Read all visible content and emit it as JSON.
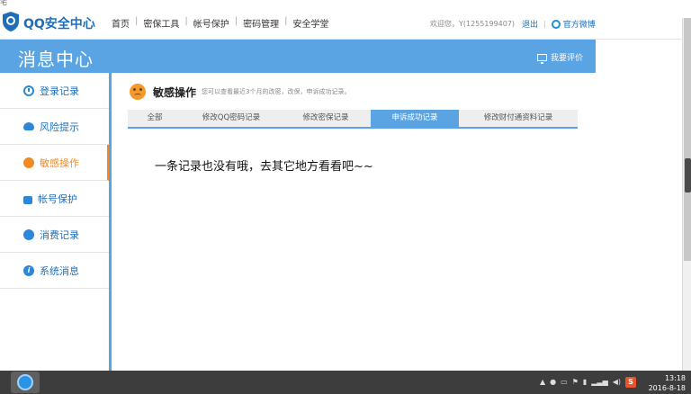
{
  "window": {
    "top_char": "宅"
  },
  "header": {
    "logo_text": "QQ安全中心",
    "nav": [
      "首页",
      "密保工具",
      "帐号保护",
      "密码管理",
      "安全学堂"
    ],
    "welcome": "欢迎您，Y(1255199407)",
    "logout": "退出",
    "weibo": "官方微博"
  },
  "banner": {
    "title": "消息中心",
    "feedback": "我要评价"
  },
  "sidebar": {
    "items": [
      {
        "label": "登录记录",
        "icon": "clock-icon"
      },
      {
        "label": "风险提示",
        "icon": "cloud-icon"
      },
      {
        "label": "敏感操作",
        "icon": "face-icon",
        "active": true
      },
      {
        "label": "帐号保护",
        "icon": "lock-icon"
      },
      {
        "label": "消费记录",
        "icon": "cart-icon"
      },
      {
        "label": "系统消息",
        "icon": "info-icon"
      }
    ]
  },
  "main": {
    "section_title": "敏感操作",
    "section_desc": "您可以查看最近3个月的改密，改保，申诉成功记录。",
    "tabs": [
      "全部",
      "修改QQ密码记录",
      "修改密保记录",
      "申诉成功记录",
      "修改财付通资料记录"
    ],
    "active_tab": 3,
    "empty_message": "一条记录也没有哦，去其它地方看看吧~~"
  },
  "taskbar": {
    "time": "13:18",
    "date": "2016-8-18",
    "ime": "S"
  },
  "colors": {
    "accent": "#5aa4e4",
    "active": "#f08a24",
    "link": "#1f6fb8"
  }
}
